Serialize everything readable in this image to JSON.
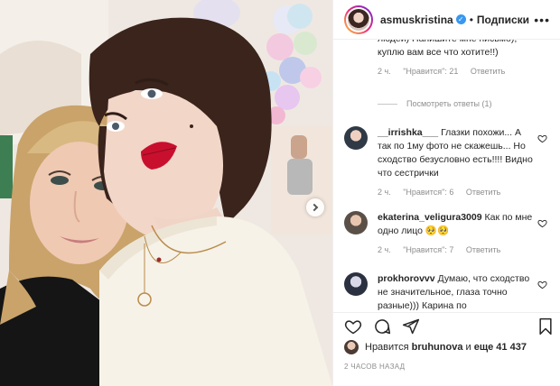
{
  "header": {
    "username": "asmuskristina",
    "verified_mark": "✓",
    "separator": "•",
    "follow_label": "Подписки",
    "more_label": "•••"
  },
  "caption_tail": {
    "text": "людей) Напишите мне письмо), куплю вам все что хотите!!)",
    "time": "2 ч.",
    "likes": "\"Нравится\": 21",
    "reply": "Ответить",
    "view_replies": "Посмотреть ответы (1)"
  },
  "comments": [
    {
      "username": "__irrishka___",
      "text": "Глазки похожи... А так по 1му фото не скажешь... Но сходство безусловно есть!!!! Видно что сестрички",
      "time": "2 ч.",
      "likes": "\"Нравится\": 6",
      "reply": "Ответить",
      "avatar_color": "#2f3a46"
    },
    {
      "username": "ekaterina_veligura3009",
      "text": "Как по мне одно лицо 🥺🥺",
      "time": "2 ч.",
      "likes": "\"Нравится\": 7",
      "reply": "Ответить",
      "avatar_color": "#5b5047"
    },
    {
      "username": "prokhorovvv",
      "text": "Думаю, что сходство не значительное, глаза точно разные))) Карина по",
      "time": "",
      "likes": "",
      "reply": "",
      "avatar_color": "#2b3140"
    }
  ],
  "actions": {
    "like_icon": "heart-icon",
    "comment_icon": "comment-icon",
    "share_icon": "share-icon",
    "save_icon": "bookmark-icon"
  },
  "likes_line": {
    "prefix": "Нравится",
    "user": "bruhunova",
    "middle": "и",
    "count": "еще 41 437"
  },
  "timestamp": "2 ЧАСОВ НАЗАД",
  "colors": {
    "link_blue": "#3897f0",
    "meta_gray": "#8e8e8e",
    "lips_red": "#c8102e"
  }
}
